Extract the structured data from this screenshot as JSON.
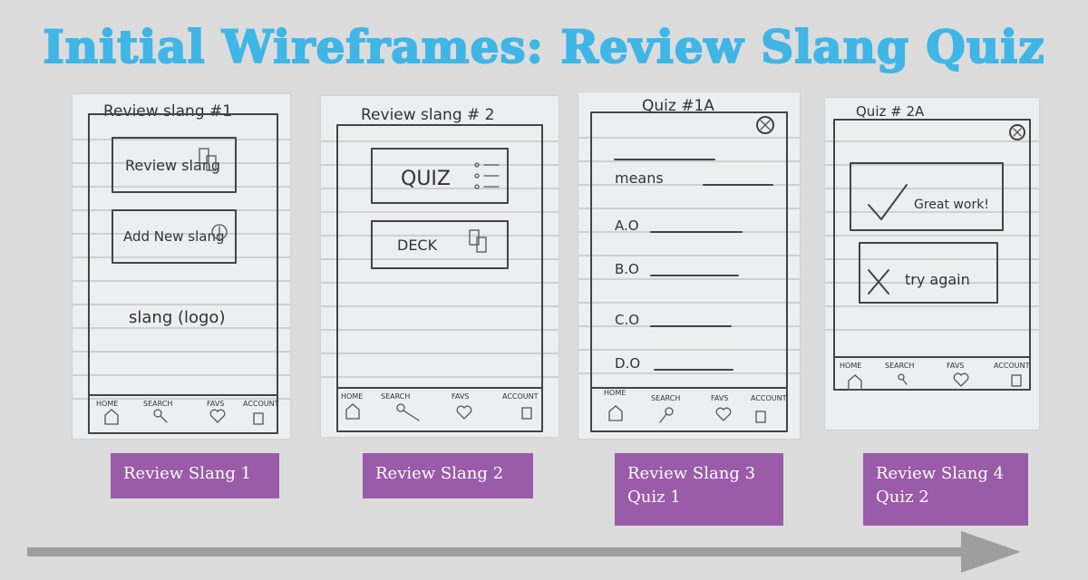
{
  "title": "Initial Wireframes: Review Slang Quiz",
  "colors": {
    "title": "#3fb6e6",
    "label_bg": "#9a5ba8",
    "background": "#dcdcdc",
    "arrow": "#9e9e9e"
  },
  "panels": [
    {
      "heading": "Review slang #1",
      "buttons": [
        "Review slang",
        "Add New slang"
      ],
      "logo_text": "slang (logo)",
      "nav": [
        "HOME",
        "SEARCH",
        "FAVS",
        "ACCOUNT"
      ],
      "caption": [
        "Review Slang 1"
      ]
    },
    {
      "heading": "Review slang # 2",
      "buttons": [
        "QUIZ",
        "DECK"
      ],
      "nav": [
        "HOME",
        "SEARCH",
        "FAVS",
        "ACCOUNT"
      ],
      "caption": [
        "Review Slang 2"
      ]
    },
    {
      "heading": "Quiz #1A",
      "prompt": "means",
      "options": [
        "A.O",
        "B.O",
        "C.O",
        "D.O"
      ],
      "nav": [
        "HOME",
        "SEARCH",
        "FAVS",
        "ACCOUNT"
      ],
      "caption": [
        "Review Slang 3",
        "Quiz 1"
      ]
    },
    {
      "heading": "Quiz # 2A",
      "buttons": [
        "Great work!",
        "try again"
      ],
      "nav": [
        "HOME",
        "SEARCH",
        "FAVS",
        "ACCOUNT"
      ],
      "caption": [
        "Review Slang 4",
        "Quiz 2"
      ]
    }
  ]
}
